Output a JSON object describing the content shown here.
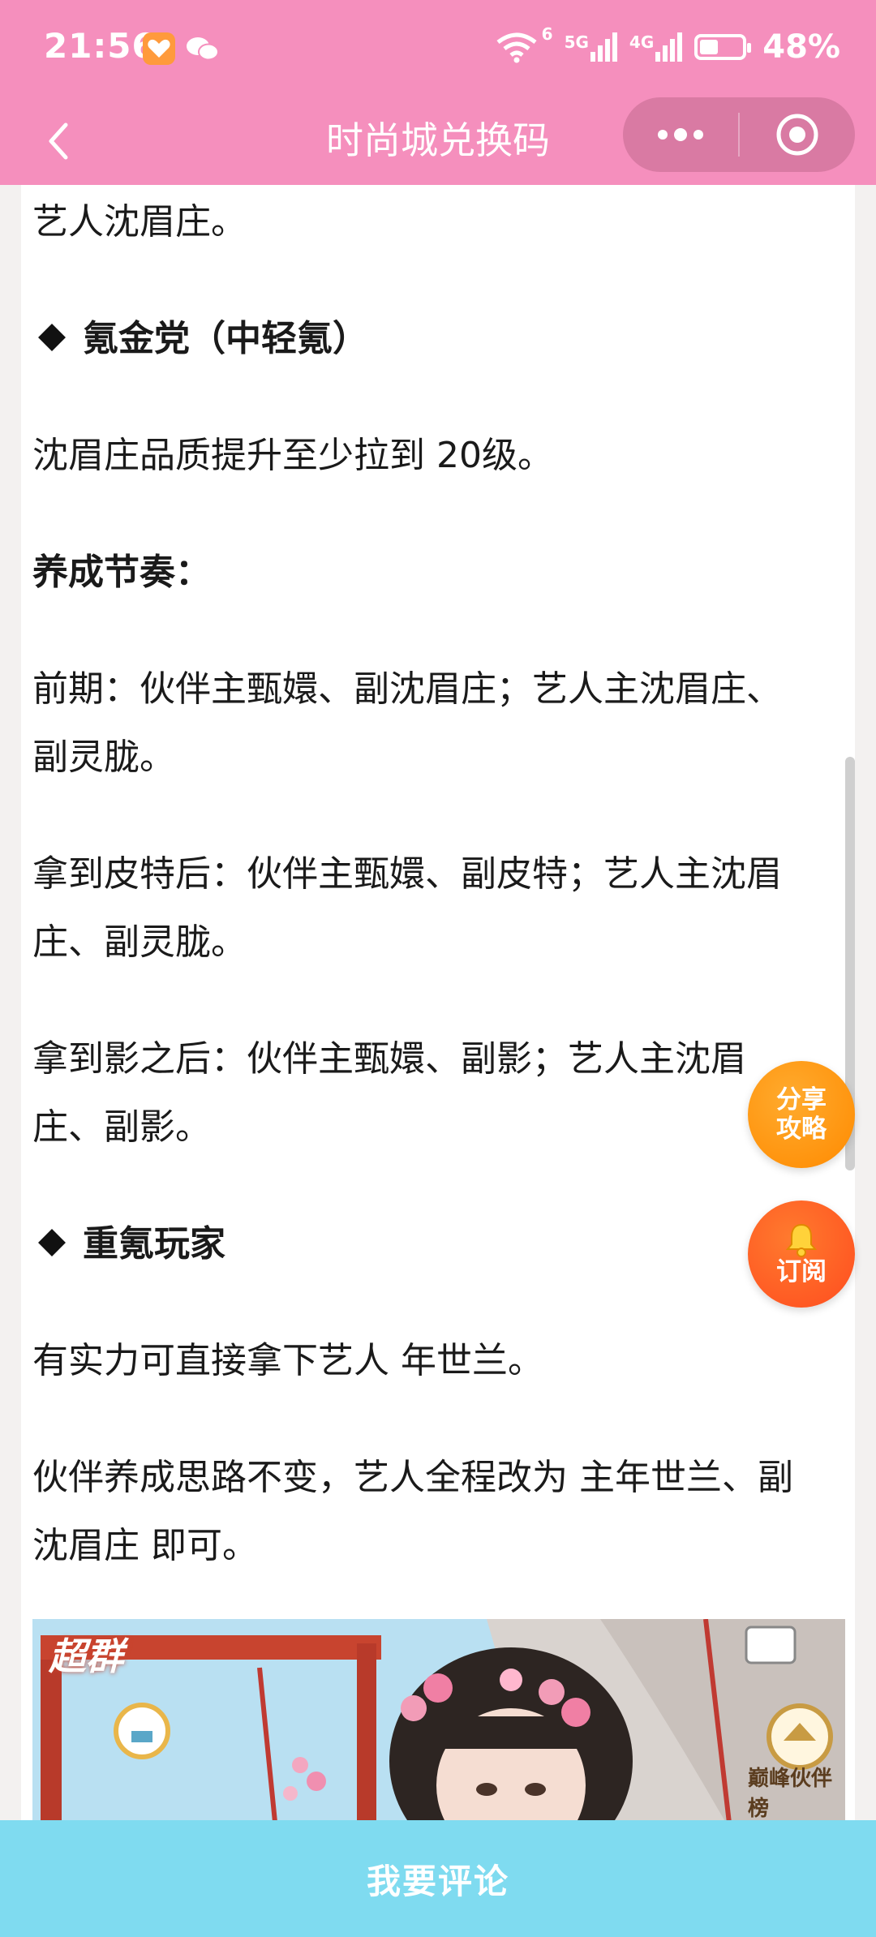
{
  "status_bar": {
    "time": "21:56",
    "network_5g": "5G",
    "network_4g": "4G",
    "wifi_sup": "6",
    "battery": "48%"
  },
  "nav": {
    "title": "时尚城兑换码"
  },
  "article": {
    "p1": "艺人沈眉庄。",
    "h1": "氪金党（中轻氪）",
    "p2": "沈眉庄品质提升至少拉到 20级。",
    "h2": "养成节奏：",
    "p3": "前期：伙伴主甄嬛、副沈眉庄；艺人主沈眉庄、副灵胧。",
    "p4": "拿到皮特后：伙伴主甄嬛、副皮特；艺人主沈眉庄、副灵胧。",
    "p5": "拿到影之后：伙伴主甄嬛、副影；艺人主沈眉庄、副影。",
    "h3": "重氪玩家",
    "p6": "有实力可直接拿下艺人 年世兰。",
    "p7": "伙伴养成思路不变，艺人全程改为 主年世兰、副沈眉庄 即可。"
  },
  "image": {
    "badge_left": "超群",
    "badge_right": "巅峰伙伴榜"
  },
  "fab": {
    "share_line1": "分享",
    "share_line2": "攻略",
    "subscribe": "订阅"
  },
  "bottom": {
    "comment_label": "我要评论"
  },
  "colors": {
    "topbar": "#f58fbd",
    "bottom": "#7fdbf0",
    "share": "#ff8a00",
    "subscribe": "#ff4d1f"
  }
}
